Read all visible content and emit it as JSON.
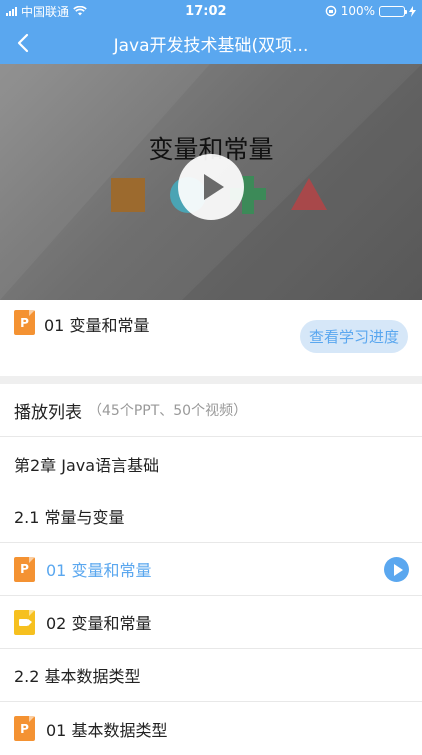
{
  "status": {
    "carrier": "中国联通",
    "time": "17:02",
    "battery": "100%"
  },
  "nav": {
    "title": "Java开发技术基础(双项...",
    "back_icon": "chevron-left-icon"
  },
  "video": {
    "title": "变量和常量",
    "shapes": [
      "square",
      "circle",
      "cross",
      "triangle"
    ]
  },
  "current": {
    "title": "01 变量和常量",
    "progress_button": "查看学习进度"
  },
  "playlist": {
    "title": "播放列表",
    "count": "（45个PPT、50个视频）",
    "items": [
      {
        "label": "第2章 Java语言基础"
      },
      {
        "label": "2.1 常量与变量"
      },
      {
        "label": "01 变量和常量"
      },
      {
        "label": "02 变量和常量"
      },
      {
        "label": "2.2 基本数据类型"
      },
      {
        "label": "01 基本数据类型"
      }
    ],
    "ppt_glyph": "P"
  },
  "colors": {
    "accent": "#5aa7ef",
    "ppt": "#f49232",
    "video": "#f6c01f"
  }
}
